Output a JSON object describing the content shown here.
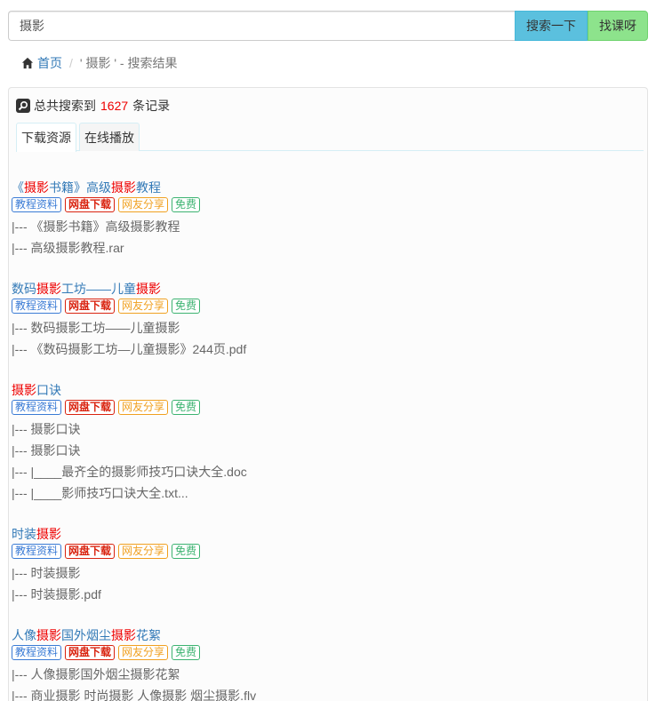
{
  "search": {
    "value": "摄影",
    "search_button": "搜索一下",
    "find_course_button": "找课呀"
  },
  "breadcrumb": {
    "home": "首页",
    "separator": "/",
    "current": "' 摄影 ' - 搜索结果"
  },
  "summary": {
    "prefix": "总共搜索到",
    "count": "1627",
    "suffix": "条记录"
  },
  "tabs": [
    "下载资源",
    "在线播放"
  ],
  "tag_labels": {
    "course": "教程资料",
    "netdisk": "网盘下载",
    "share": "网友分享",
    "free": "免费"
  },
  "results": [
    {
      "title_parts": [
        "《",
        "摄影",
        "书籍》高级",
        "摄影",
        "教程"
      ],
      "files": [
        "|--- 《摄影书籍》高级摄影教程",
        "|--- 高级摄影教程.rar"
      ]
    },
    {
      "title_parts": [
        "数码",
        "摄影",
        "工坊——儿童",
        "摄影",
        ""
      ],
      "files": [
        "|--- 数码摄影工坊——儿童摄影",
        "|--- 《数码摄影工坊—儿童摄影》244页.pdf"
      ]
    },
    {
      "title_parts": [
        "",
        "摄影",
        "口诀",
        "",
        ""
      ],
      "files": [
        "|--- 摄影口诀",
        "|--- 摄影口诀",
        "|--- |____最齐全的摄影师技巧口诀大全.doc",
        "|--- |____影师技巧口诀大全.txt..."
      ]
    },
    {
      "title_parts": [
        "时装",
        "摄影",
        "",
        "",
        ""
      ],
      "files": [
        "|--- 时装摄影",
        "|--- 时装摄影.pdf"
      ]
    },
    {
      "title_parts": [
        "人像",
        "摄影",
        "国外烟尘",
        "摄影",
        "花絮"
      ],
      "files": [
        "|--- 人像摄影国外烟尘摄影花絮",
        "|--- 商业摄影 时尚摄影 人像摄影 烟尘摄影.flv"
      ]
    }
  ],
  "colors": {
    "link": "#337ab7",
    "highlight": "#e00000",
    "search_button": "#5bc0de",
    "find_button": "#8de38c"
  },
  "icons": {
    "home": "home-icon",
    "search": "search-icon"
  }
}
